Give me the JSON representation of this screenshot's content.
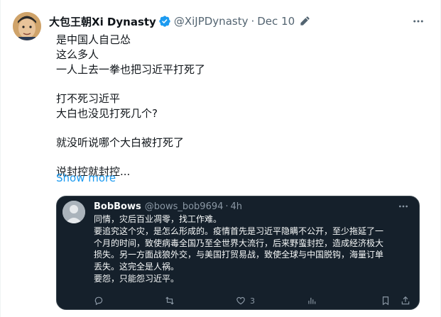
{
  "tweet": {
    "author": {
      "display_name": "大包王朝Xi Dynasty",
      "handle": "@XiJPDynasty",
      "separator": "·",
      "date": "Dec 10"
    },
    "lines": [
      "是中国人自己怂",
      "这么多人",
      "一人上去一拳也把习近平打死了",
      "",
      "打不死习近平",
      "大白也没见打死几个?",
      "",
      "就没听说哪个大白被打死了",
      "",
      "说封控就封控..."
    ],
    "show_more_label": "Show more"
  },
  "quote": {
    "author": {
      "display_name": "BobBows",
      "handle": "@bows_bob9694",
      "separator": "·",
      "time": "4h"
    },
    "lines": [
      "同情，灾后百业凋零，找工作难。",
      "要追究这个灾，是怎么形成的。疫情首先是习近平隐瞒不公开，至少拖延了一",
      "个月的时间，致使病毒全国乃至全世界大流行，后来野蛮封控，造成经济极大",
      "损失。另一方面战狼外交，与美国打贸易战，致使全球与中国脱钩，海量订单",
      "丢失。这完全是人祸。",
      "要怨，只能怨习近平。"
    ],
    "actions": {
      "reply_count": "",
      "retweet_count": "",
      "like_count": "3"
    }
  },
  "colors": {
    "accent": "#1d9bf0",
    "quote_background": "#15202b",
    "muted": "#536471"
  }
}
